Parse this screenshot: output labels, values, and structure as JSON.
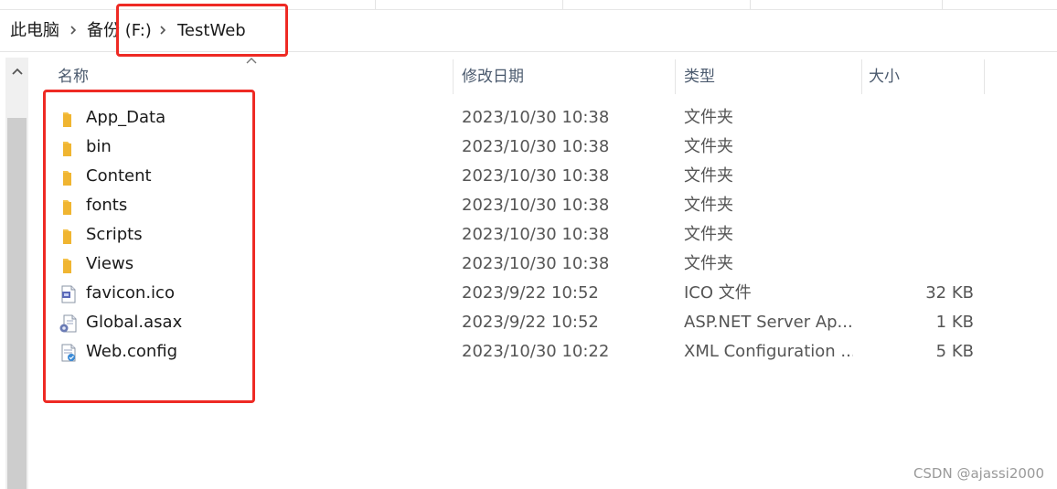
{
  "breadcrumb": {
    "items": [
      "此电脑",
      "备份 (F:)",
      "TestWeb"
    ]
  },
  "columns": {
    "name": "名称",
    "modified": "修改日期",
    "type": "类型",
    "size": "大小"
  },
  "files": [
    {
      "name": "App_Data",
      "modified": "2023/10/30 10:38",
      "type": "文件夹",
      "size": "",
      "icon": "folder-icon"
    },
    {
      "name": "bin",
      "modified": "2023/10/30 10:38",
      "type": "文件夹",
      "size": "",
      "icon": "folder-icon"
    },
    {
      "name": "Content",
      "modified": "2023/10/30 10:38",
      "type": "文件夹",
      "size": "",
      "icon": "folder-icon"
    },
    {
      "name": "fonts",
      "modified": "2023/10/30 10:38",
      "type": "文件夹",
      "size": "",
      "icon": "folder-icon"
    },
    {
      "name": "Scripts",
      "modified": "2023/10/30 10:38",
      "type": "文件夹",
      "size": "",
      "icon": "folder-icon"
    },
    {
      "name": "Views",
      "modified": "2023/10/30 10:38",
      "type": "文件夹",
      "size": "",
      "icon": "folder-icon"
    },
    {
      "name": "favicon.ico",
      "modified": "2023/9/22 10:52",
      "type": "ICO 文件",
      "size": "32 KB",
      "icon": "ico-file-icon"
    },
    {
      "name": "Global.asax",
      "modified": "2023/9/22 10:52",
      "type": "ASP.NET Server Ap...",
      "size": "1 KB",
      "icon": "asax-file-icon"
    },
    {
      "name": "Web.config",
      "modified": "2023/10/30 10:22",
      "type": "XML Configuration ...",
      "size": "5 KB",
      "icon": "config-file-icon"
    }
  ],
  "watermark": "CSDN @ajassi2000",
  "colors": {
    "highlight_box": "#ee2a24",
    "folder": "#f5c24a",
    "header_text": "#4b5a6e"
  }
}
